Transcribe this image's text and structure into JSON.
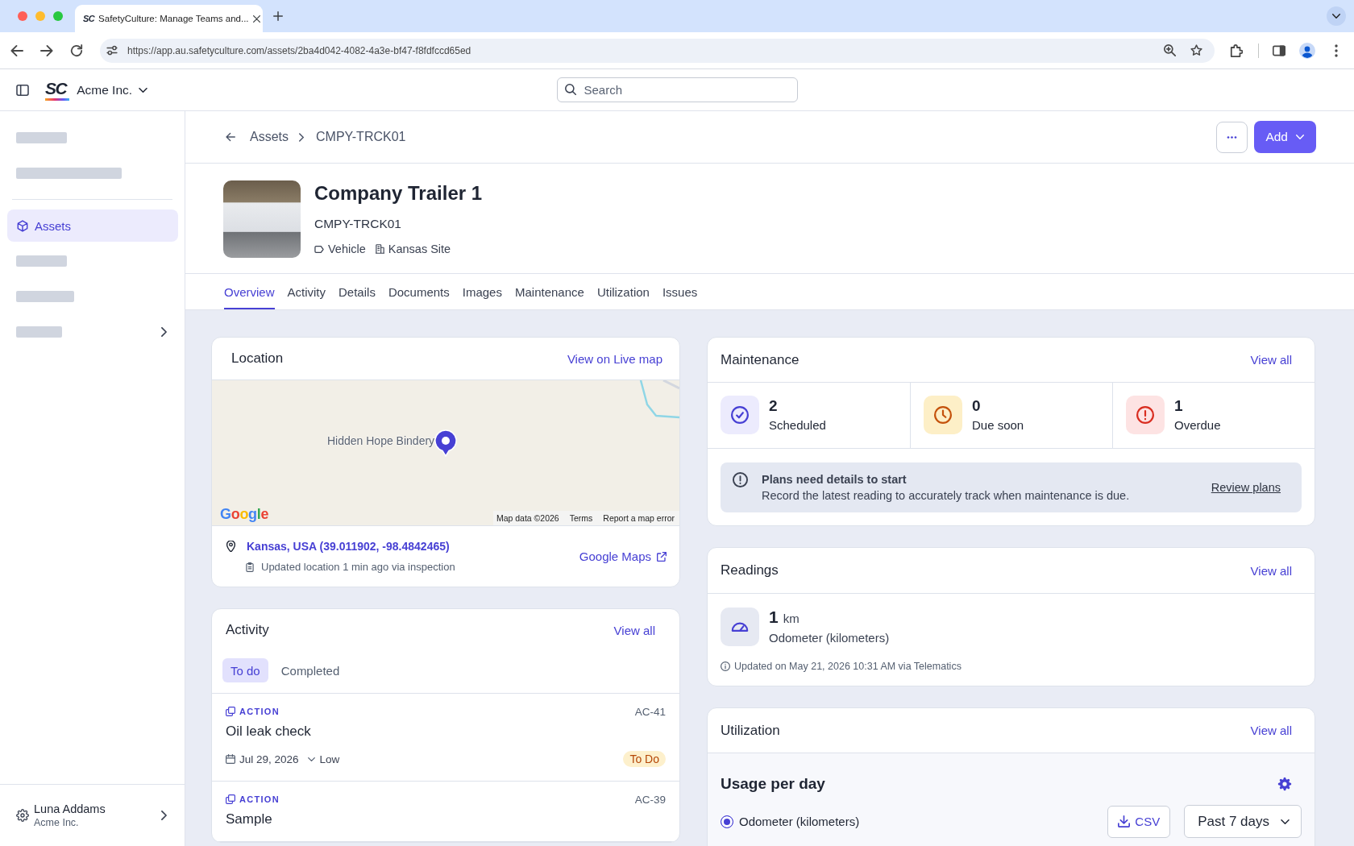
{
  "browser": {
    "tab": {
      "logo": "SC",
      "title": "SafetyCulture: Manage Teams and..."
    },
    "url": "https://app.au.safetyculture.com/assets/2ba4d042-4082-4a3e-bf47-f8fdfccd65ed"
  },
  "app_header": {
    "logo": "SC",
    "organization": "Acme Inc.",
    "search": {
      "placeholder": "Search"
    }
  },
  "sidebar": {
    "sections": [
      {
        "items": [
          {
            "kind": "skeleton",
            "selected": false
          },
          {
            "kind": "skeleton",
            "selected": false
          }
        ]
      },
      {
        "items": [
          {
            "kind": "link",
            "label": "Assets",
            "selected": true
          },
          {
            "kind": "skeleton",
            "selected": false
          },
          {
            "kind": "skeleton",
            "selected": false
          },
          {
            "kind": "skeleton",
            "selected": false,
            "expanded": false
          }
        ]
      }
    ],
    "user": {
      "name": "Luna Addams",
      "organization": "Acme Inc."
    }
  },
  "breadcrumbs": [
    "Assets",
    "CMPY-TRCK01"
  ],
  "header_actions": [
    {
      "kind": "more"
    },
    {
      "kind": "primary",
      "label": "Add"
    }
  ],
  "asset": {
    "name": "Company Trailer 1",
    "code": "CMPY-TRCK01",
    "type": "Vehicle",
    "site": "Kansas Site"
  },
  "tabs": [
    {
      "label": "Overview",
      "selected": true
    },
    {
      "label": "Activity",
      "selected": false
    },
    {
      "label": "Details",
      "selected": false
    },
    {
      "label": "Documents",
      "selected": false
    },
    {
      "label": "Images",
      "selected": false
    },
    {
      "label": "Maintenance",
      "selected": false
    },
    {
      "label": "Utilization",
      "selected": false
    },
    {
      "label": "Issues",
      "selected": false
    }
  ],
  "location": {
    "title": "Location",
    "link": "View on Live map",
    "map": {
      "place_label": "Hidden Hope Bindery",
      "logo": "Google",
      "attribution": [
        "Map data ©2026",
        "Terms",
        "Report a map error"
      ]
    },
    "address": "Kansas, USA (39.011902, -98.4842465)",
    "updated": "Updated location 1 min ago via inspection",
    "external_link": "Google Maps"
  },
  "activity": {
    "title": "Activity",
    "link": "View all",
    "filters": [
      {
        "label": "To do",
        "selected": true
      },
      {
        "label": "Completed",
        "selected": false
      }
    ],
    "items": [
      {
        "type": "ACTION",
        "id": "AC-41",
        "title": "Oil leak check",
        "due": "Jul 29, 2026",
        "priority": "Low",
        "status": "To Do"
      },
      {
        "type": "ACTION",
        "id": "AC-39",
        "title": "Sample"
      }
    ]
  },
  "maintenance": {
    "title": "Maintenance",
    "link": "View all",
    "stats": [
      {
        "kind": "scheduled",
        "count": "2",
        "label": "Scheduled"
      },
      {
        "kind": "due_soon",
        "count": "0",
        "label": "Due soon"
      },
      {
        "kind": "overdue",
        "count": "1",
        "label": "Overdue"
      }
    ],
    "notice": {
      "title": "Plans need details to start",
      "text": "Record the latest reading to accurately track when maintenance is due.",
      "link": "Review plans"
    }
  },
  "readings": {
    "title": "Readings",
    "link": "View all",
    "items": [
      {
        "value": "1",
        "unit": "km",
        "label": "Odometer (kilometers)",
        "updated": "Updated on May 21, 2026 10:31 AM via Telematics"
      }
    ]
  },
  "utilization": {
    "title": "Utilization",
    "link": "View all",
    "heading": "Usage per day",
    "series": [
      {
        "label": "Odometer (kilometers)",
        "selected": true
      }
    ],
    "export": "CSV",
    "range": "Past 7 days"
  }
}
